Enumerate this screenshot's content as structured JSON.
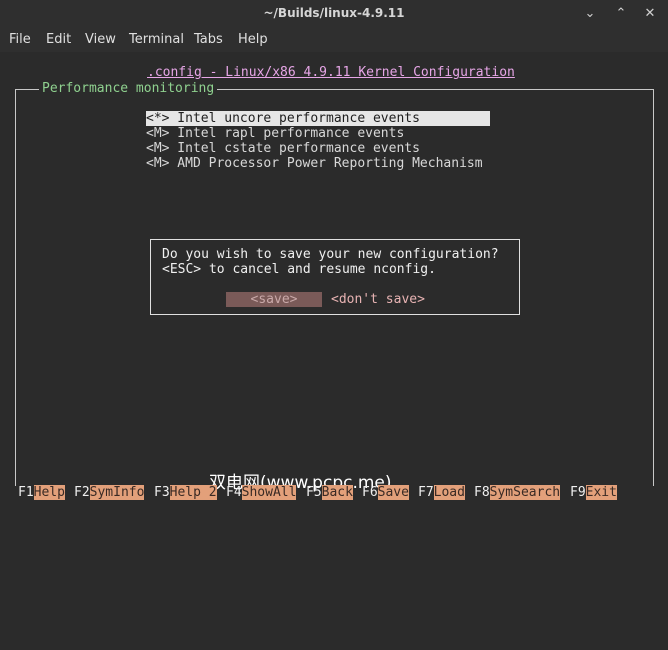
{
  "window": {
    "title": "~/Builds/linux-4.9.11",
    "controls": {
      "minimize": "⌄",
      "maximize": "⌃",
      "close": "✕"
    }
  },
  "menubar": [
    "File",
    "Edit",
    "View",
    "Terminal",
    "Tabs",
    "Help"
  ],
  "config_header": ".config - Linux/x86 4.9.11 Kernel Configuration",
  "section_title": "Performance monitoring",
  "options": [
    {
      "text": "<*> Intel uncore performance events",
      "selected": true
    },
    {
      "text": "<M> Intel rapl performance events",
      "selected": false
    },
    {
      "text": "<M> Intel cstate performance events",
      "selected": false
    },
    {
      "text": "<M> AMD Processor Power Reporting Mechanism",
      "selected": false
    }
  ],
  "dialog": {
    "line1": "Do you wish to save your new configuration?",
    "line2": "<ESC> to cancel and resume nconfig.",
    "save_button": "<save>",
    "dont_save_button": "<don't save>"
  },
  "function_keys": [
    {
      "key": "F1",
      "label": "Help"
    },
    {
      "key": "F2",
      "label": "SymInfo"
    },
    {
      "key": "F3",
      "label": "Help 2"
    },
    {
      "key": "F4",
      "label": "ShowAll"
    },
    {
      "key": "F5",
      "label": "Back"
    },
    {
      "key": "F6",
      "label": "Save"
    },
    {
      "key": "F7",
      "label": "Load"
    },
    {
      "key": "F8",
      "label": "SymSearch"
    },
    {
      "key": "F9",
      "label": "Exit"
    }
  ],
  "watermark": "双电网(www.pcpc.me)",
  "colors": {
    "terminal_bg": "#2b2b2b",
    "header_magenta": "#e7a6e7",
    "section_green": "#8fd18f",
    "fkey_label_bg": "#e3a07a",
    "save_button_bg": "#7a5a58"
  }
}
